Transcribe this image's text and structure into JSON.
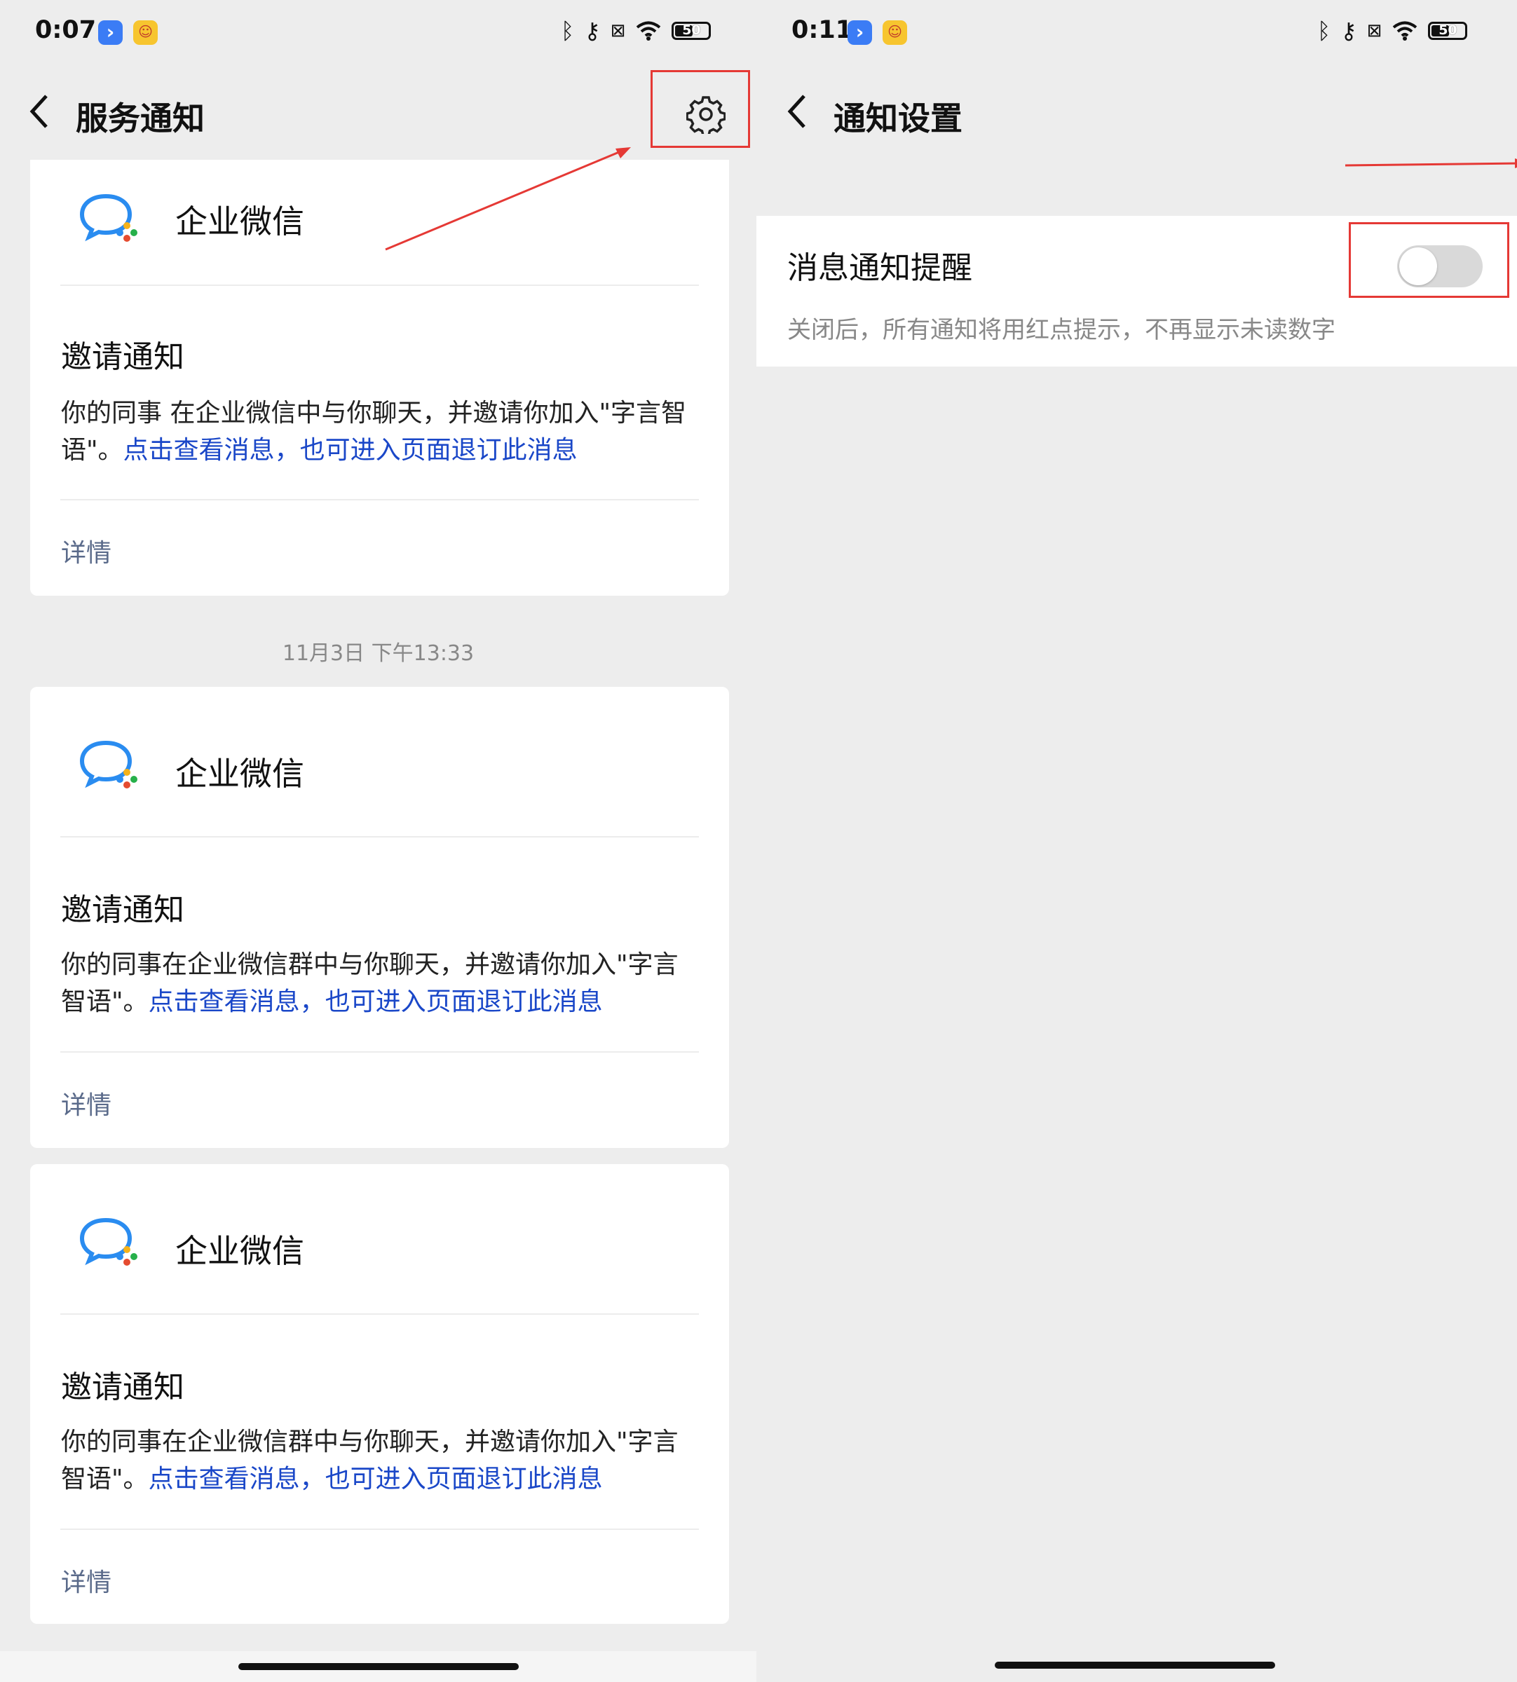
{
  "left": {
    "status": {
      "time": "0:07",
      "battery": "50"
    },
    "title": "服务通知",
    "timestamp": "11月3日 下午13:33",
    "cards": [
      {
        "app": "企业微信",
        "title": "邀请通知",
        "body": "你的同事 在企业微信中与你聊天，并邀请你加入\"字言智语\"。",
        "link": "点击查看消息，也可进入页面退订此消息",
        "details": "详情"
      },
      {
        "app": "企业微信",
        "title": "邀请通知",
        "body": "你的同事在企业微信群中与你聊天，并邀请你加入\"字言智语\"。",
        "link": "点击查看消息，也可进入页面退订此消息",
        "details": "详情"
      },
      {
        "app": "企业微信",
        "title": "邀请通知",
        "body": "你的同事在企业微信群中与你聊天，并邀请你加入\"字言智语\"。",
        "link": "点击查看消息，也可进入页面退订此消息",
        "details": "详情"
      }
    ]
  },
  "right": {
    "status": {
      "time": "0:11",
      "battery": "50"
    },
    "title": "通知设置",
    "setting": {
      "label": "消息通知提醒",
      "description": "关闭后，所有通知将用红点提示，不再显示未读数字",
      "enabled": false
    }
  },
  "colors": {
    "accent_link": "#1a47c8",
    "annotation_red": "#e53935",
    "toggle_off": "#d9d9d9"
  }
}
